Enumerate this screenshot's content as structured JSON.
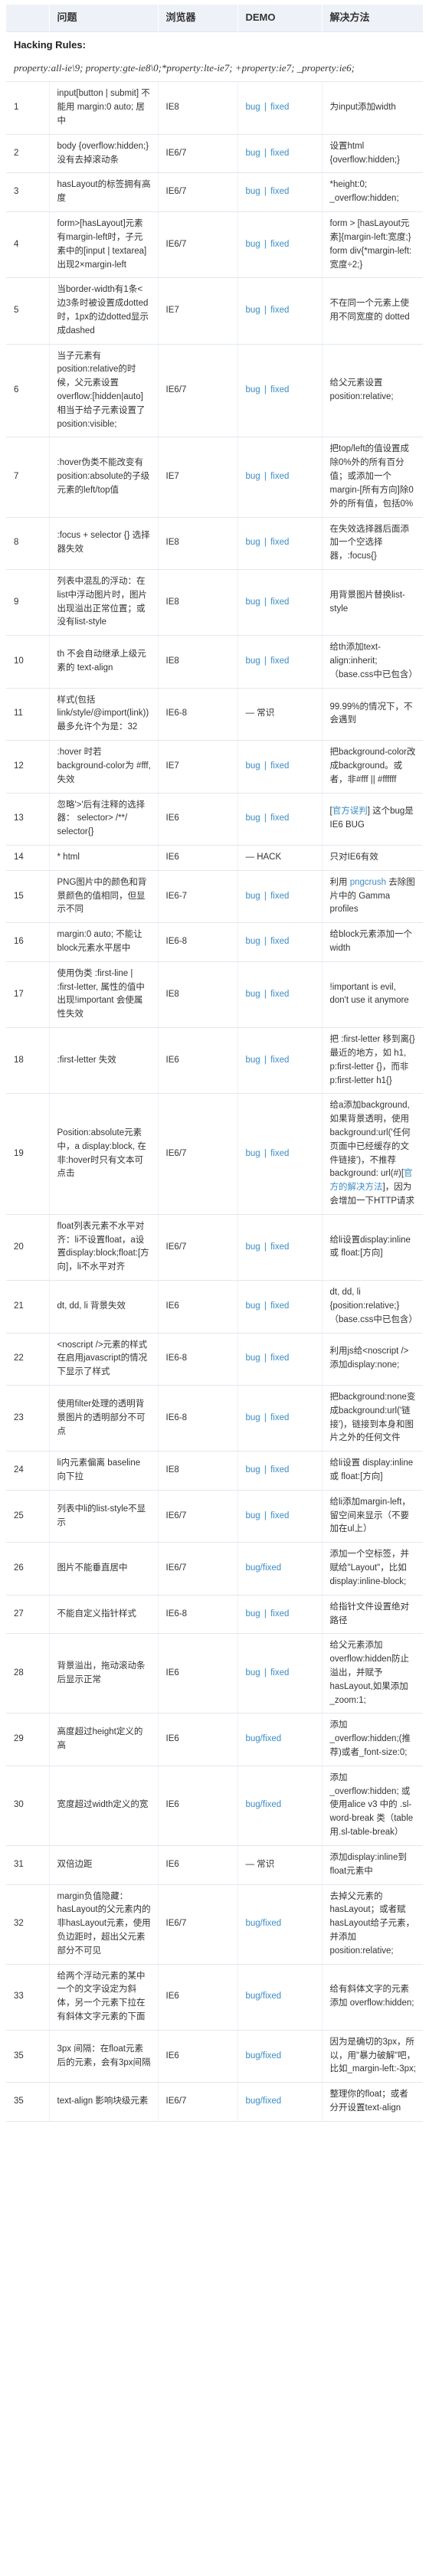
{
  "table": {
    "headers": [
      "",
      "问题",
      "浏览器",
      "DEMO",
      "解决方法"
    ],
    "rules": {
      "title": "Hacking Rules:",
      "body": "property:all-ie\\9; property:gte-ie8\\0;*property:lte-ie7; +property:ie7; _property:ie6;"
    },
    "demo_labels": {
      "bug": "bug",
      "fixed": "fixed",
      "separator": "|",
      "bug_fixed": "bug/fixed",
      "common": "— 常识",
      "hack": "— HACK"
    },
    "rows": [
      {
        "idx": "1",
        "issue": "input[button | submit] 不能用 margin:0 auto; 居中",
        "browser": "IE8",
        "demo_type": "links",
        "fix": "为input添加width"
      },
      {
        "idx": "2",
        "issue": "body {overflow:hidden;} 没有去掉滚动条",
        "browser": "IE6/7",
        "demo_type": "links",
        "fix": "设置html {overflow:hidden;}"
      },
      {
        "idx": "3",
        "issue": "hasLayout的标签拥有高度",
        "browser": "IE6/7",
        "demo_type": "links",
        "fix": "*height:0; _overflow:hidden;"
      },
      {
        "idx": "4",
        "issue": "form>[hasLayout]元素有margin-left时，子元素中的[input | textarea]出现2×margin-left",
        "browser": "IE6/7",
        "demo_type": "links",
        "fix": "form > [hasLayout元素]{margin-left:宽度;} form div{*margin-left:宽度÷2;}"
      },
      {
        "idx": "5",
        "issue": "当border-width有1条<边3条时被设置成dotted时，1px的边dotted显示成dashed",
        "browser": "IE7",
        "demo_type": "links",
        "fix": "不在同一个元素上使用不同宽度的 dotted"
      },
      {
        "idx": "6",
        "issue": "当子元素有position:relative的时候，父元素设置overflow:[hidden|auto]相当于给子元素设置了position:visible;",
        "browser": "IE6/7",
        "demo_type": "links",
        "fix": "给父元素设置 position:relative;"
      },
      {
        "idx": "7",
        "issue": ":hover伪类不能改变有position:absolute的子级元素的left/top值",
        "browser": "IE7",
        "demo_type": "links",
        "fix": "把top/left的值设置成除0%外的所有百分值；或添加一个margin-[所有方向]除0外的所有值，包括0%"
      },
      {
        "idx": "8",
        "issue": ":focus + selector {} 选择器失效",
        "browser": "IE8",
        "demo_type": "links",
        "fix": "在失效选择器后面添加一个空选择器，:focus{}"
      },
      {
        "idx": "9",
        "issue": "列表中混乱的浮动：在list中浮动图片时，图片出现溢出正常位置；或没有list-style",
        "browser": "IE8",
        "demo_type": "links",
        "fix": "用背景图片替换list-style"
      },
      {
        "idx": "10",
        "issue": "th 不会自动继承上级元素的 text-align",
        "browser": "IE8",
        "demo_type": "links",
        "fix": "给th添加text-align:inherit;（base.css中已包含）"
      },
      {
        "idx": "11",
        "issue": "样式(包括link/style/@import(link)) 最多允许个为是：32",
        "browser": "IE6-8",
        "demo_type": "common",
        "fix": "99.99%的情况下，不会遇到"
      },
      {
        "idx": "12",
        "issue": ":hover 时若 background-color为 #fff, 失效",
        "browser": "IE7",
        "demo_type": "links",
        "fix": "把background-color改成background。或者，非#fff || #ffffff"
      },
      {
        "idx": "13",
        "issue": "忽略'>'后有注释的选择器： selector> /**/ selector{}",
        "browser": "IE6",
        "demo_type": "links",
        "fix_link": "官方误判",
        "fix_prefix": "[",
        "fix_suffix": "] 这个bug是IE6 BUG"
      },
      {
        "idx": "14",
        "issue": "* html",
        "browser": "IE6",
        "demo_type": "hack",
        "fix": "只对IE6有效"
      },
      {
        "idx": "15",
        "issue": "PNG图片中的颜色和背景颜色的值相同，但显示不同",
        "browser": "IE6-7",
        "demo_type": "links",
        "fix_prefix": "利用 ",
        "fix_link": "pngcrush",
        "fix_suffix": " 去除图片中的 Gamma profiles"
      },
      {
        "idx": "16",
        "issue": "margin:0 auto; 不能让block元素水平居中",
        "browser": "IE6-8",
        "demo_type": "links",
        "fix": "给block元素添加一个width"
      },
      {
        "idx": "17",
        "issue": "使用伪类 :first-line | :first-letter, 属性的值中出现!important 会使属性失效",
        "browser": "IE8",
        "demo_type": "links",
        "fix": "!important is evil, don't use it anymore"
      },
      {
        "idx": "18",
        "issue": ":first-letter 失效",
        "browser": "IE6",
        "demo_type": "links",
        "fix": "把 :first-letter 移到离{}最近的地方，如 h1, p:first-letter {}，而非 p:first-letter h1{}"
      },
      {
        "idx": "19",
        "issue": "Position:absolute元素中，a display:block, 在非:hover时只有文本可点击",
        "browser": "IE6/7",
        "demo_type": "links",
        "fix_prefix": "给a添加background, 如果背景透明，使用background:url('任何页面中已经缓存的文件链接')，不推荐background: url(#)[",
        "fix_link": "官方的解决方法",
        "fix_suffix": "]，因为会增加一下HTTP请求"
      },
      {
        "idx": "20",
        "issue": "float列表元素不水平对齐：li不设置float，a设置display:block;float:[方向]，li不水平对齐",
        "browser": "IE6/7",
        "demo_type": "links",
        "fix": "给li设置display:inline 或 float:[方向]"
      },
      {
        "idx": "21",
        "issue": "dt, dd, li 背景失效",
        "browser": "IE6",
        "demo_type": "links",
        "fix": "dt, dd, li {position:relative;}（base.css中已包含）"
      },
      {
        "idx": "22",
        "issue": "<noscript />元素的样式在启用javascript的情况下显示了样式",
        "browser": "IE6-8",
        "demo_type": "links",
        "fix": "利用js给<noscript />添加display:none;"
      },
      {
        "idx": "23",
        "issue": "使用filter处理的透明背景图片的透明部分不可点",
        "browser": "IE6-8",
        "demo_type": "links",
        "fix": "把background:none变成background:url('链接')，链接到本身和图片之外的任何文件"
      },
      {
        "idx": "24",
        "issue": "li内元素偏离 baseline 向下拉",
        "browser": "IE8",
        "demo_type": "links",
        "fix": "给li设置 display:inline 或 float:[方向]"
      },
      {
        "idx": "25",
        "issue": "列表中li的list-style不显示",
        "browser": "IE6/7",
        "demo_type": "links",
        "fix": "给li添加margin-left，留空间来显示（不要加在ul上）"
      },
      {
        "idx": "26",
        "issue": "图片不能垂直居中",
        "browser": "IE6/7",
        "demo_type": "bug_fixed",
        "fix": "添加一个空标签，并赋给\"Layout\"，比如 display:inline-block;"
      },
      {
        "idx": "27",
        "issue": "不能自定义指针样式",
        "browser": "IE6-8",
        "demo_type": "links",
        "fix": "给指针文件设置绝对路径"
      },
      {
        "idx": "28",
        "issue": "背景溢出，拖动滚动条后显示正常",
        "browser": "IE6",
        "demo_type": "links",
        "fix": "给父元素添加overflow:hidden防止溢出，并赋予hasLayout,如果添加_zoom:1;"
      },
      {
        "idx": "29",
        "issue": "高度超过height定义的高",
        "browser": "IE6",
        "demo_type": "bug_fixed",
        "fix": "添加 _overflow:hidden;(推荐)或者_font-size:0;"
      },
      {
        "idx": "30",
        "issue": "宽度超过width定义的宽",
        "browser": "IE6",
        "demo_type": "bug_fixed",
        "fix": "添加 _overflow:hidden; 或使用alice v3 中的 .sl-word-break 类（table用.sl-table-break）"
      },
      {
        "idx": "31",
        "issue": "双倍边距",
        "browser": "IE6",
        "demo_type": "common",
        "fix": "添加display:inline到float元素中"
      },
      {
        "idx": "32",
        "issue": "margin负值隐藏：hasLayout的父元素内的非hasLayout元素，使用负边距时，超出父元素部分不可见",
        "browser": "IE6/7",
        "demo_type": "bug_fixed",
        "fix": "去掉父元素的hasLayout；或者赋hasLayout给子元素，并添加 position:relative;"
      },
      {
        "idx": "33",
        "issue": "给两个浮动元素的某中一个的文字设定为斜体，另一个元素下拉在有斜体文字元素的下面",
        "browser": "IE6",
        "demo_type": "bug_fixed",
        "fix": "给有斜体文字的元素添加 overflow:hidden;"
      },
      {
        "idx": "35",
        "issue": "3px 间隔：在float元素后的元素，会有3px间隔",
        "browser": "IE6",
        "demo_type": "bug_fixed",
        "fix": "因为是确切的3px，所以，用\"暴力破解\"吧，比如_margin-left:-3px;"
      },
      {
        "idx": "35",
        "issue": "text-align 影响块级元素",
        "browser": "IE6/7",
        "demo_type": "bug_fixed",
        "fix": "整理你的float；或者分开设置text-align"
      }
    ]
  }
}
